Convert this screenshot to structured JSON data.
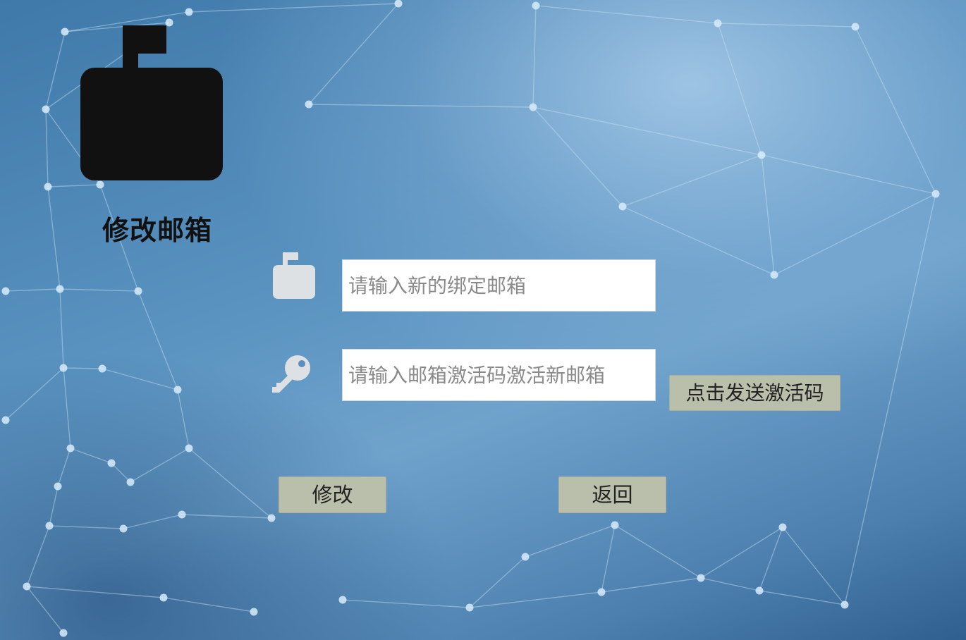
{
  "page": {
    "title": "修改邮箱"
  },
  "form": {
    "email_input": {
      "value": "",
      "placeholder": "请输入新的绑定邮箱"
    },
    "code_input": {
      "value": "",
      "placeholder": "请输入邮箱激活码激活新邮箱"
    },
    "send_code_label": "点击发送激活码",
    "submit_label": "修改",
    "back_label": "返回"
  },
  "icons": {
    "app": "mailbox-icon",
    "email_field": "mailbox-icon",
    "code_field": "key-icon"
  },
  "colors": {
    "button_bg": "#b9bfaa",
    "title_text": "#111111",
    "field_icon": "#dde1e4",
    "background_primary": "#5a93c0"
  }
}
